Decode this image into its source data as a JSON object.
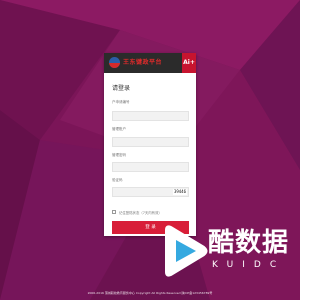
{
  "colors": {
    "background": "#7b1558",
    "accent": "#d81e38",
    "header": "#2b2b2b"
  },
  "header": {
    "brand_name": "王东键政平台",
    "badge": "Ai+"
  },
  "form": {
    "title": "请登录",
    "username_label": "户申请编号",
    "password_label": "管理账户",
    "password2_label": "管理密码",
    "captcha_label": "验证码",
    "captcha_value": "39446",
    "remember_label": "记住登陆状态（7天内有效）",
    "submit_label": "登 录"
  },
  "footer": {
    "text": "2006-2016 蒲城职校教育服务中心 Copyright All Rights Reserved 陕ICP备123456789号"
  },
  "watermark": {
    "text": "酷数据",
    "subtext": "KUIDC"
  }
}
